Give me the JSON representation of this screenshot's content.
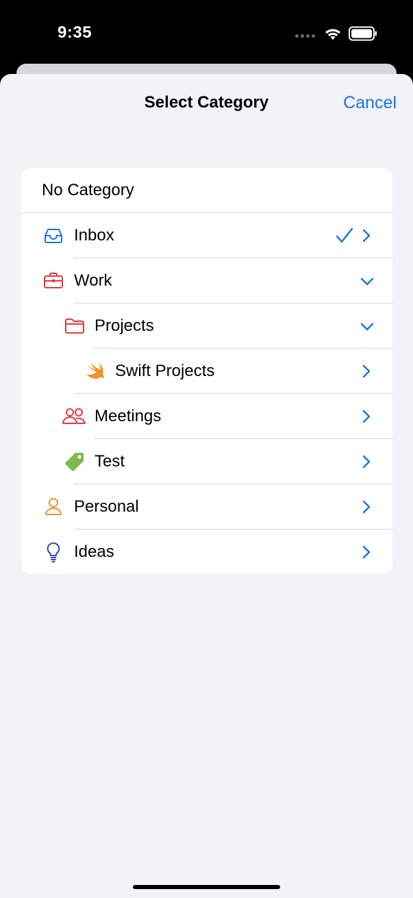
{
  "status_bar": {
    "time": "9:35"
  },
  "header": {
    "title": "Select Category",
    "cancel_label": "Cancel"
  },
  "categories": [
    {
      "label": "No Category",
      "icon": "none"
    },
    {
      "label": "Inbox",
      "icon": "tray-icon",
      "selected": true
    },
    {
      "label": "Work",
      "icon": "briefcase-icon",
      "expanded": true
    },
    {
      "label": "Projects",
      "icon": "folder-icon",
      "expanded": true
    },
    {
      "label": "Swift Projects",
      "icon": "swift-icon"
    },
    {
      "label": "Meetings",
      "icon": "people-icon"
    },
    {
      "label": "Test",
      "icon": "tag-icon"
    },
    {
      "label": "Personal",
      "icon": "person-icon"
    },
    {
      "label": "Ideas",
      "icon": "lightbulb-icon"
    }
  ],
  "colors": {
    "accent": "#1a73e8",
    "work": "#e5383b",
    "personal": "#f5902c",
    "ideas": "#3f3fbf",
    "tag": "#7dbb4c",
    "swift": "#f5902c"
  }
}
